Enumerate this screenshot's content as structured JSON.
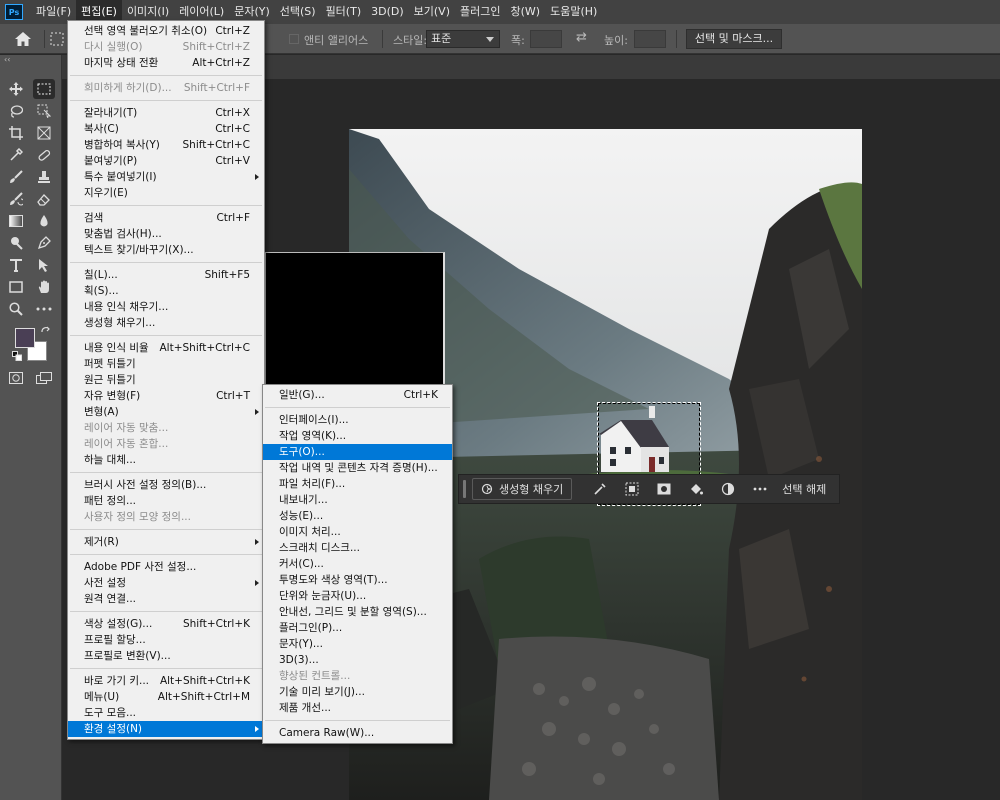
{
  "menubar": {
    "items": [
      {
        "label": "파일(F)"
      },
      {
        "label": "편집(E)",
        "active": true
      },
      {
        "label": "이미지(I)"
      },
      {
        "label": "레이어(L)"
      },
      {
        "label": "문자(Y)"
      },
      {
        "label": "선택(S)"
      },
      {
        "label": "필터(T)"
      },
      {
        "label": "3D(D)"
      },
      {
        "label": "보기(V)"
      },
      {
        "label": "플러그인"
      },
      {
        "label": "창(W)"
      },
      {
        "label": "도움말(H)"
      }
    ]
  },
  "options_bar": {
    "anti_alias_label": "앤티 앨리어스",
    "style_label": "스타일:",
    "style_value": "표준",
    "width_label": "폭:",
    "height_label": "높이:",
    "select_mask_button": "선택 및 마스크..."
  },
  "colors": {
    "foreground": "#4a3f55",
    "background": "#ffffff",
    "accent": "#0078d7"
  },
  "edit_menu": {
    "groups": [
      [
        {
          "label": "선택 영역 불러오기 취소(O)",
          "shortcut": "Ctrl+Z"
        },
        {
          "label": "다시 실행(O)",
          "shortcut": "Shift+Ctrl+Z",
          "disabled": true
        },
        {
          "label": "마지막 상태 전환",
          "shortcut": "Alt+Ctrl+Z"
        }
      ],
      [
        {
          "label": "희미하게 하기(D)...",
          "shortcut": "Shift+Ctrl+F",
          "disabled": true
        }
      ],
      [
        {
          "label": "잘라내기(T)",
          "shortcut": "Ctrl+X"
        },
        {
          "label": "복사(C)",
          "shortcut": "Ctrl+C"
        },
        {
          "label": "병합하여 복사(Y)",
          "shortcut": "Shift+Ctrl+C"
        },
        {
          "label": "붙여넣기(P)",
          "shortcut": "Ctrl+V"
        },
        {
          "label": "특수 붙여넣기(I)",
          "submenu": true
        },
        {
          "label": "지우기(E)"
        }
      ],
      [
        {
          "label": "검색",
          "shortcut": "Ctrl+F"
        },
        {
          "label": "맞춤법 검사(H)..."
        },
        {
          "label": "텍스트 찾기/바꾸기(X)..."
        }
      ],
      [
        {
          "label": "칠(L)...",
          "shortcut": "Shift+F5"
        },
        {
          "label": "획(S)..."
        },
        {
          "label": "내용 인식 채우기..."
        },
        {
          "label": "생성형 채우기..."
        }
      ],
      [
        {
          "label": "내용 인식 비율",
          "shortcut": "Alt+Shift+Ctrl+C"
        },
        {
          "label": "퍼펫 뒤틀기"
        },
        {
          "label": "원근 뒤틀기"
        },
        {
          "label": "자유 변형(F)",
          "shortcut": "Ctrl+T"
        },
        {
          "label": "변형(A)",
          "submenu": true
        },
        {
          "label": "레이어 자동 맞춤...",
          "disabled": true
        },
        {
          "label": "레이어 자동 혼합...",
          "disabled": true
        },
        {
          "label": "하늘 대체..."
        }
      ],
      [
        {
          "label": "브러시 사전 설정 정의(B)..."
        },
        {
          "label": "패턴 정의..."
        },
        {
          "label": "사용자 정의 모양 정의...",
          "disabled": true
        }
      ],
      [
        {
          "label": "제거(R)",
          "submenu": true
        }
      ],
      [
        {
          "label": "Adobe PDF 사전 설정..."
        },
        {
          "label": "사전 설정",
          "submenu": true
        },
        {
          "label": "원격 연결..."
        }
      ],
      [
        {
          "label": "색상 설정(G)...",
          "shortcut": "Shift+Ctrl+K"
        },
        {
          "label": "프로필 할당..."
        },
        {
          "label": "프로필로 변환(V)..."
        }
      ],
      [
        {
          "label": "바로 가기 키...",
          "shortcut": "Alt+Shift+Ctrl+K"
        },
        {
          "label": "메뉴(U)",
          "shortcut": "Alt+Shift+Ctrl+M"
        },
        {
          "label": "도구 모음..."
        },
        {
          "label": "환경 설정(N)",
          "submenu": true,
          "highlighted": true
        }
      ]
    ]
  },
  "preferences_menu": {
    "groups": [
      [
        {
          "label": "일반(G)...",
          "shortcut": "Ctrl+K"
        }
      ],
      [
        {
          "label": "인터페이스(I)..."
        },
        {
          "label": "작업 영역(K)..."
        },
        {
          "label": "도구(O)...",
          "highlighted": true
        },
        {
          "label": "작업 내역 및 콘텐츠 자격 증명(H)..."
        },
        {
          "label": "파일 처리(F)..."
        },
        {
          "label": "내보내기..."
        },
        {
          "label": "성능(E)..."
        },
        {
          "label": "이미지 처리..."
        },
        {
          "label": "스크래치 디스크..."
        },
        {
          "label": "커서(C)..."
        },
        {
          "label": "투명도와 색상 영역(T)..."
        },
        {
          "label": "단위와 눈금자(U)..."
        },
        {
          "label": "안내선, 그리드 및 분할 영역(S)..."
        },
        {
          "label": "플러그인(P)..."
        },
        {
          "label": "문자(Y)..."
        },
        {
          "label": "3D(3)..."
        },
        {
          "label": "향상된 컨트롤...",
          "disabled": true
        },
        {
          "label": "기술 미리 보기(J)..."
        },
        {
          "label": "제품 개선..."
        }
      ],
      [
        {
          "label": "Camera Raw(W)..."
        }
      ]
    ]
  },
  "taskbar": {
    "generative_fill_label": "생성형 채우기",
    "deselect_label": "선택 해제"
  }
}
